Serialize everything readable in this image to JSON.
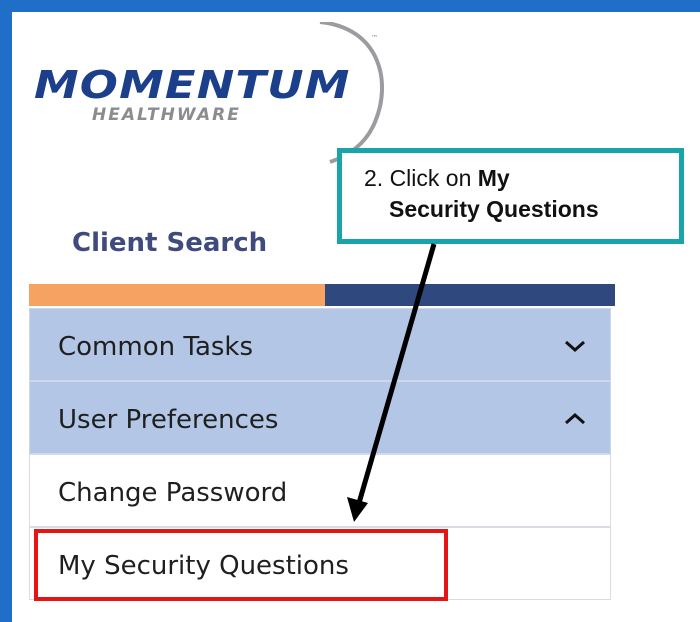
{
  "logo": {
    "word": "MOMENTUM",
    "sub": "HEALTHWARE",
    "tm": "™",
    "icon": "momentum-logo-arc"
  },
  "nav": {
    "client_search": "Client Search"
  },
  "menu": {
    "common_tasks": "Common Tasks",
    "user_preferences": "User Preferences",
    "change_password": "Change Password",
    "my_security_questions": "My Security Questions",
    "common_tasks_icon": "chevron-down-icon",
    "user_preferences_icon": "chevron-up-icon"
  },
  "callout": {
    "step": "2. Click on ",
    "bold1": "My",
    "line2": "Security Questions"
  },
  "colors": {
    "frame": "#1f6fc8",
    "header_row": "#b3c6e6",
    "accent_orange": "#f6a263",
    "accent_navy": "#2f487d",
    "callout_border": "#19a3aa",
    "highlight": "#e61515"
  }
}
